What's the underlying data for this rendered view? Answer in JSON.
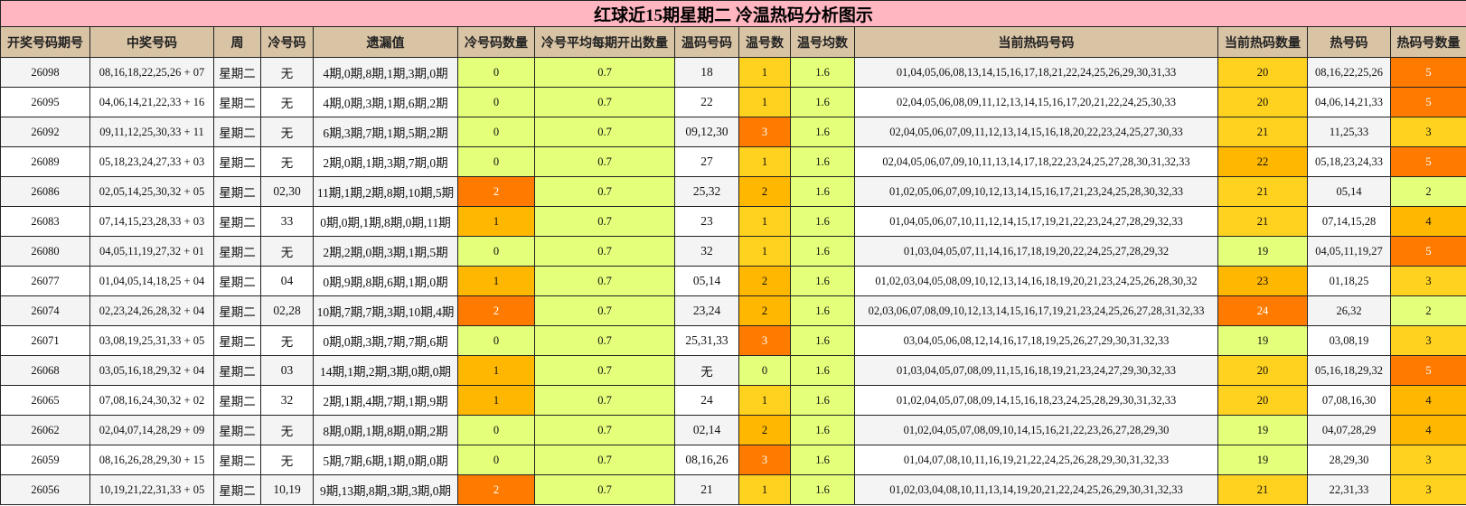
{
  "title": "红球近15期星期二 冷温热码分析图示",
  "headers": [
    "开奖号码期号",
    "中奖号码",
    "周",
    "冷号码",
    "遗漏值",
    "冷号码数量",
    "冷号平均每期开出数量",
    "温码号码",
    "温号数",
    "温号均数",
    "当前热码号码",
    "当前热码数量",
    "热号码",
    "热码号数量"
  ],
  "colors": {
    "c0": "#e4ff7a",
    "c1": "#ffd21f",
    "c2": "#ffb700",
    "c3": "#ff8a00",
    "c4": "#ff7b00"
  },
  "rows": [
    {
      "issue": "26098",
      "numbers": "08,16,18,22,25,26 + 07",
      "week": "星期二",
      "cold": "无",
      "miss": "4期,0期,8期,1期,3期,0期",
      "cold_count": "0",
      "cold_avg": "0.7",
      "warm": "18",
      "warm_count": "1",
      "warm_avg": "1.6",
      "hot_now": "01,04,05,06,08,13,14,15,16,17,18,21,22,24,25,26,29,30,31,33",
      "hot_now_count": "20",
      "hot": "08,16,22,25,26",
      "hot_count": "5"
    },
    {
      "issue": "26095",
      "numbers": "04,06,14,21,22,33 + 16",
      "week": "星期二",
      "cold": "无",
      "miss": "4期,0期,3期,1期,6期,2期",
      "cold_count": "0",
      "cold_avg": "0.7",
      "warm": "22",
      "warm_count": "1",
      "warm_avg": "1.6",
      "hot_now": "02,04,05,06,08,09,11,12,13,14,15,16,17,20,21,22,24,25,30,33",
      "hot_now_count": "20",
      "hot": "04,06,14,21,33",
      "hot_count": "5"
    },
    {
      "issue": "26092",
      "numbers": "09,11,12,25,30,33 + 11",
      "week": "星期二",
      "cold": "无",
      "miss": "6期,3期,7期,1期,5期,2期",
      "cold_count": "0",
      "cold_avg": "0.7",
      "warm": "09,12,30",
      "warm_count": "3",
      "warm_avg": "1.6",
      "hot_now": "02,04,05,06,07,09,11,12,13,14,15,16,18,20,22,23,24,25,27,30,33",
      "hot_now_count": "21",
      "hot": "11,25,33",
      "hot_count": "3"
    },
    {
      "issue": "26089",
      "numbers": "05,18,23,24,27,33 + 03",
      "week": "星期二",
      "cold": "无",
      "miss": "2期,0期,1期,3期,7期,0期",
      "cold_count": "0",
      "cold_avg": "0.7",
      "warm": "27",
      "warm_count": "1",
      "warm_avg": "1.6",
      "hot_now": "02,04,05,06,07,09,10,11,13,14,17,18,22,23,24,25,27,28,30,31,32,33",
      "hot_now_count": "22",
      "hot": "05,18,23,24,33",
      "hot_count": "5"
    },
    {
      "issue": "26086",
      "numbers": "02,05,14,25,30,32 + 05",
      "week": "星期二",
      "cold": "02,30",
      "miss": "11期,1期,2期,8期,10期,5期",
      "cold_count": "2",
      "cold_avg": "0.7",
      "warm": "25,32",
      "warm_count": "2",
      "warm_avg": "1.6",
      "hot_now": "01,02,05,06,07,09,10,12,13,14,15,16,17,21,23,24,25,28,30,32,33",
      "hot_now_count": "21",
      "hot": "05,14",
      "hot_count": "2"
    },
    {
      "issue": "26083",
      "numbers": "07,14,15,23,28,33 + 03",
      "week": "星期二",
      "cold": "33",
      "miss": "0期,0期,1期,8期,0期,11期",
      "cold_count": "1",
      "cold_avg": "0.7",
      "warm": "23",
      "warm_count": "1",
      "warm_avg": "1.6",
      "hot_now": "01,04,05,06,07,10,11,12,14,15,17,19,21,22,23,24,27,28,29,32,33",
      "hot_now_count": "21",
      "hot": "07,14,15,28",
      "hot_count": "4"
    },
    {
      "issue": "26080",
      "numbers": "04,05,11,19,27,32 + 01",
      "week": "星期二",
      "cold": "无",
      "miss": "2期,2期,0期,3期,1期,5期",
      "cold_count": "0",
      "cold_avg": "0.7",
      "warm": "32",
      "warm_count": "1",
      "warm_avg": "1.6",
      "hot_now": "01,03,04,05,07,11,14,16,17,18,19,20,22,24,25,27,28,29,32",
      "hot_now_count": "19",
      "hot": "04,05,11,19,27",
      "hot_count": "5"
    },
    {
      "issue": "26077",
      "numbers": "01,04,05,14,18,25 + 04",
      "week": "星期二",
      "cold": "04",
      "miss": "0期,9期,8期,6期,1期,0期",
      "cold_count": "1",
      "cold_avg": "0.7",
      "warm": "05,14",
      "warm_count": "2",
      "warm_avg": "1.6",
      "hot_now": "01,02,03,04,05,08,09,10,12,13,14,16,18,19,20,21,23,24,25,26,28,30,32",
      "hot_now_count": "23",
      "hot": "01,18,25",
      "hot_count": "3"
    },
    {
      "issue": "26074",
      "numbers": "02,23,24,26,28,32 + 04",
      "week": "星期二",
      "cold": "02,28",
      "miss": "10期,7期,7期,3期,10期,4期",
      "cold_count": "2",
      "cold_avg": "0.7",
      "warm": "23,24",
      "warm_count": "2",
      "warm_avg": "1.6",
      "hot_now": "02,03,06,07,08,09,10,12,13,14,15,16,17,19,21,23,24,25,26,27,28,31,32,33",
      "hot_now_count": "24",
      "hot": "26,32",
      "hot_count": "2"
    },
    {
      "issue": "26071",
      "numbers": "03,08,19,25,31,33 + 05",
      "week": "星期二",
      "cold": "无",
      "miss": "0期,0期,3期,7期,7期,6期",
      "cold_count": "0",
      "cold_avg": "0.7",
      "warm": "25,31,33",
      "warm_count": "3",
      "warm_avg": "1.6",
      "hot_now": "03,04,05,06,08,12,14,16,17,18,19,25,26,27,29,30,31,32,33",
      "hot_now_count": "19",
      "hot": "03,08,19",
      "hot_count": "3"
    },
    {
      "issue": "26068",
      "numbers": "03,05,16,18,29,32 + 04",
      "week": "星期二",
      "cold": "03",
      "miss": "14期,1期,2期,3期,0期,0期",
      "cold_count": "1",
      "cold_avg": "0.7",
      "warm": "无",
      "warm_count": "0",
      "warm_avg": "1.6",
      "hot_now": "01,03,04,05,07,08,09,11,15,16,18,19,21,23,24,27,29,30,32,33",
      "hot_now_count": "20",
      "hot": "05,16,18,29,32",
      "hot_count": "5"
    },
    {
      "issue": "26065",
      "numbers": "07,08,16,24,30,32 + 02",
      "week": "星期二",
      "cold": "32",
      "miss": "2期,1期,4期,7期,1期,9期",
      "cold_count": "1",
      "cold_avg": "0.7",
      "warm": "24",
      "warm_count": "1",
      "warm_avg": "1.6",
      "hot_now": "01,02,04,05,07,08,09,14,15,16,18,23,24,25,28,29,30,31,32,33",
      "hot_now_count": "20",
      "hot": "07,08,16,30",
      "hot_count": "4"
    },
    {
      "issue": "26062",
      "numbers": "02,04,07,14,28,29 + 09",
      "week": "星期二",
      "cold": "无",
      "miss": "8期,0期,1期,8期,0期,2期",
      "cold_count": "0",
      "cold_avg": "0.7",
      "warm": "02,14",
      "warm_count": "2",
      "warm_avg": "1.6",
      "hot_now": "01,02,04,05,07,08,09,10,14,15,16,21,22,23,26,27,28,29,30",
      "hot_now_count": "19",
      "hot": "04,07,28,29",
      "hot_count": "4"
    },
    {
      "issue": "26059",
      "numbers": "08,16,26,28,29,30 + 15",
      "week": "星期二",
      "cold": "无",
      "miss": "5期,7期,6期,1期,0期,0期",
      "cold_count": "0",
      "cold_avg": "0.7",
      "warm": "08,16,26",
      "warm_count": "3",
      "warm_avg": "1.6",
      "hot_now": "01,04,07,08,10,11,16,19,21,22,24,25,26,28,29,30,31,32,33",
      "hot_now_count": "19",
      "hot": "28,29,30",
      "hot_count": "3"
    },
    {
      "issue": "26056",
      "numbers": "10,19,21,22,31,33 + 05",
      "week": "星期二",
      "cold": "10,19",
      "miss": "9期,13期,8期,3期,3期,0期",
      "cold_count": "2",
      "cold_avg": "0.7",
      "warm": "21",
      "warm_count": "1",
      "warm_avg": "1.6",
      "hot_now": "01,02,03,04,08,10,11,13,14,19,20,21,22,24,25,26,29,30,31,32,33",
      "hot_now_count": "21",
      "hot": "22,31,33",
      "hot_count": "3"
    }
  ]
}
